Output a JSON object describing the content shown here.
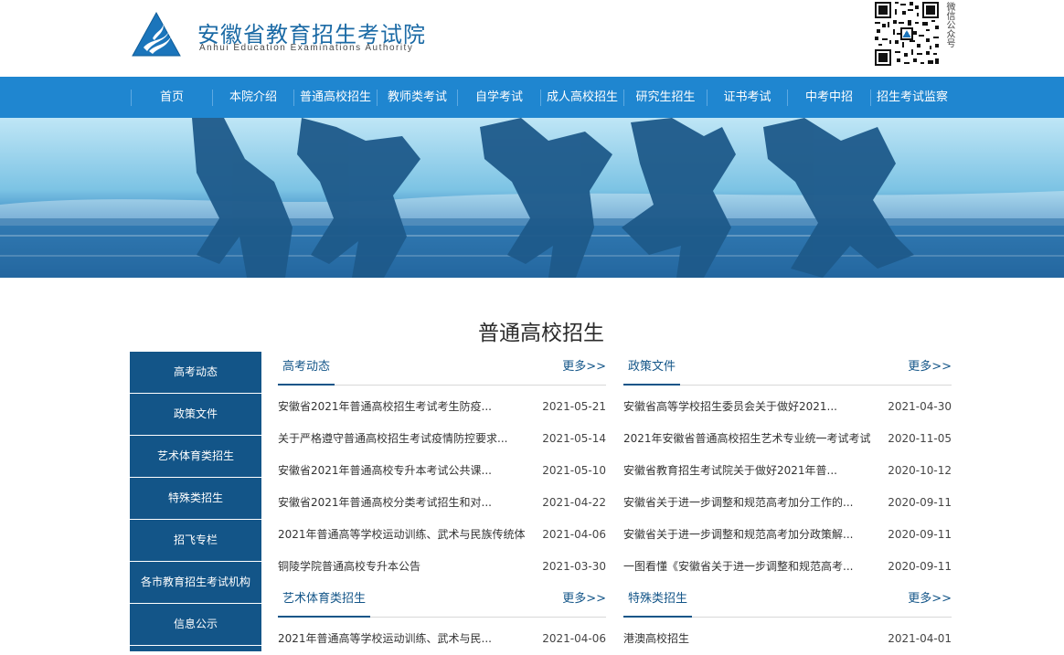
{
  "header": {
    "site_title": "安徽省教育招生考试院",
    "site_subtitle": "Anhui Education Examinations Authority",
    "qr_caption": "微信公众号"
  },
  "nav": {
    "items": [
      "首页",
      "本院介绍",
      "普通高校招生",
      "教师类考试",
      "自学考试",
      "成人高校招生",
      "研究生招生",
      "证书考试",
      "中考中招",
      "招生考试监察"
    ]
  },
  "section": {
    "title": "普通高校招生"
  },
  "sidebar": {
    "items": [
      "高考动态",
      "政策文件",
      "艺术体育类招生",
      "特殊类招生",
      "招飞专栏",
      "各市教育招生考试机构",
      "信息公示"
    ]
  },
  "panels": [
    {
      "title": "高考动态",
      "more": "更多>>",
      "rows": [
        {
          "title": "安徽省2021年普通高校招生考试考生防疫...",
          "date": "2021-05-21"
        },
        {
          "title": "关于严格遵守普通高校招生考试疫情防控要求...",
          "date": "2021-05-14"
        },
        {
          "title": "安徽省2021年普通高校专升本考试公共课...",
          "date": "2021-05-10"
        },
        {
          "title": "安徽省2021年普通高校分类考试招生和对...",
          "date": "2021-04-22"
        },
        {
          "title": "2021年普通高等学校运动训练、武术与民族传统体...",
          "date": "2021-04-06"
        },
        {
          "title": "铜陵学院普通高校专升本公告",
          "date": "2021-03-30"
        }
      ]
    },
    {
      "title": "政策文件",
      "more": "更多>>",
      "rows": [
        {
          "title": "安徽省高等学校招生委员会关于做好2021...",
          "date": "2021-04-30"
        },
        {
          "title": "2021年安徽省普通高校招生艺术专业统一考试考试...",
          "date": "2020-11-05"
        },
        {
          "title": "安徽省教育招生考试院关于做好2021年普...",
          "date": "2020-10-12"
        },
        {
          "title": "安徽省关于进一步调整和规范高考加分工作的...",
          "date": "2020-09-11"
        },
        {
          "title": "安徽省关于进一步调整和规范高考加分政策解...",
          "date": "2020-09-11"
        },
        {
          "title": "一图看懂《安徽省关于进一步调整和规范高考...",
          "date": "2020-09-11"
        }
      ]
    },
    {
      "title": "艺术体育类招生",
      "more": "更多>>",
      "rows": [
        {
          "title": "2021年普通高等学校运动训练、武术与民...",
          "date": "2021-04-06"
        }
      ]
    },
    {
      "title": "特殊类招生",
      "more": "更多>>",
      "rows": [
        {
          "title": "港澳高校招生",
          "date": "2021-04-01"
        }
      ]
    }
  ],
  "colors": {
    "nav_blue": "#1f86d0",
    "sidebar_navy": "#135588",
    "brand_blue": "#1b6aa5"
  },
  "icons": {
    "logo": "triangle-logo-icon",
    "qr": "qr-code-icon"
  }
}
